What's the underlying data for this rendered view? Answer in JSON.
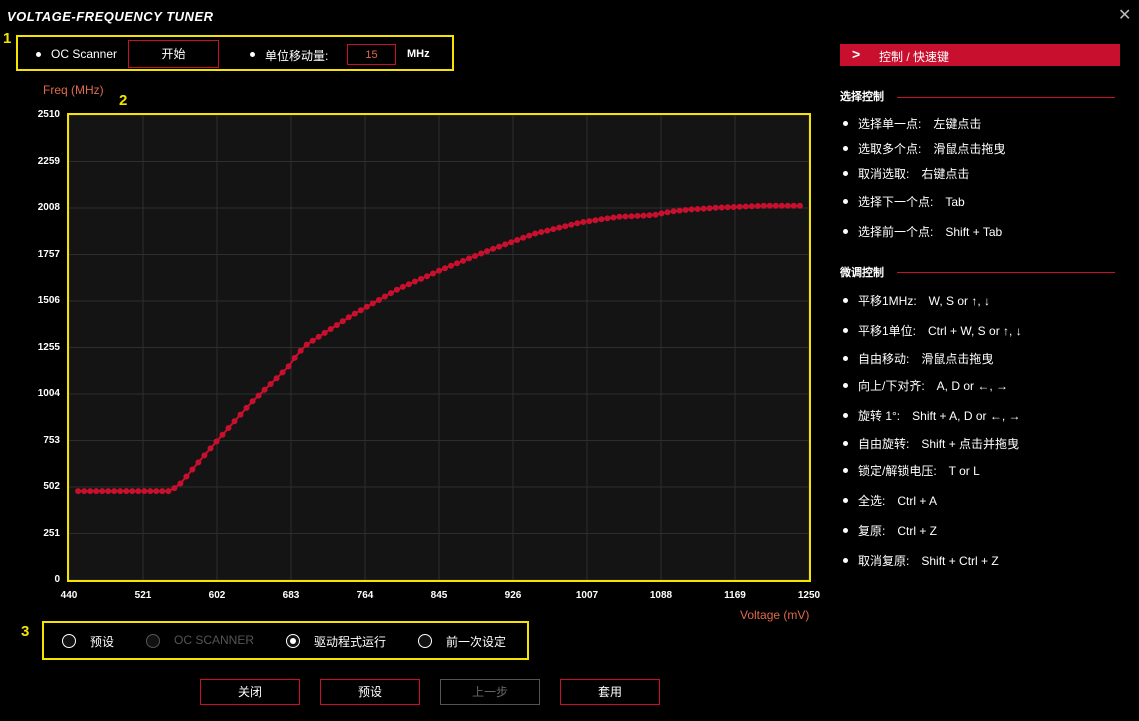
{
  "window": {
    "title": "VOLTAGE-FREQUENCY TUNER",
    "close_icon": "close-icon"
  },
  "annotations": [
    "1",
    "2",
    "3"
  ],
  "top_bar": {
    "oc_scanner_label": "OC Scanner",
    "start_button": "开始",
    "step_label": "单位移动量:",
    "step_value": "15",
    "step_unit": "MHz"
  },
  "chart_data": {
    "type": "line",
    "ylabel": "Freq (MHz)",
    "xlabel": "Voltage (mV)",
    "xlim": [
      440,
      1250
    ],
    "ylim": [
      0,
      2510
    ],
    "x_ticks": [
      "440",
      "521",
      "602",
      "683",
      "764",
      "845",
      "926",
      "1007",
      "1088",
      "1169",
      "1250"
    ],
    "y_ticks": [
      "0",
      "251",
      "502",
      "753",
      "1004",
      "1255",
      "1506",
      "1757",
      "2008",
      "2259",
      "2510"
    ],
    "grid": true,
    "color": "#c8102e",
    "series": [
      {
        "x": [
          450,
          550,
          560,
          600,
          640,
          680,
          690,
          700,
          750,
          800,
          850,
          900,
          950,
          1000,
          1040,
          1080,
          1100,
          1120,
          1150,
          1200,
          1240
        ],
        "y": [
          480,
          480,
          510,
          740,
          960,
          1150,
          1220,
          1270,
          1430,
          1570,
          1680,
          1780,
          1870,
          1930,
          1960,
          1970,
          1990,
          2000,
          2010,
          2020,
          2020
        ]
      }
    ]
  },
  "profiles": {
    "options": [
      {
        "label": "预设",
        "disabled": false,
        "checked": false
      },
      {
        "label": "OC SCANNER",
        "disabled": true,
        "checked": false
      },
      {
        "label": "驱动程式运行",
        "disabled": false,
        "checked": true
      },
      {
        "label": "前一次设定",
        "disabled": false,
        "checked": false
      }
    ]
  },
  "buttons": {
    "close": "关闭",
    "preset": "预设",
    "undo": "上一步",
    "apply": "套用"
  },
  "help_panel": {
    "header_arrow": ">",
    "header": "控制 / 快速键",
    "select_title": "选择控制",
    "select_items": [
      {
        "action": "选择单一点:",
        "key": "左键点击"
      },
      {
        "action": "选取多个点:",
        "key": "滑鼠点击拖曳"
      },
      {
        "action": "取消选取:",
        "key": "右键点击"
      },
      {
        "action": "选择下一个点:",
        "key": "Tab"
      },
      {
        "action": "选择前一个点:",
        "key": "Shift + Tab"
      }
    ],
    "fine_title": "微调控制",
    "fine_items": [
      {
        "action": "平移1MHz:",
        "key": "W, S or ↑, ↓"
      },
      {
        "action": "平移1单位:",
        "key": "Ctrl + W, S or ↑, ↓"
      },
      {
        "action": "自由移动:",
        "key": "滑鼠点击拖曳"
      },
      {
        "action": "向上/下对齐:",
        "key": "A, D or ←, →"
      },
      {
        "action": "旋转 1°:",
        "key": "Shift + A, D or ←, →"
      },
      {
        "action": "自由旋转:",
        "key": "Shift + 点击并拖曳"
      },
      {
        "action": "锁定/解锁电压:",
        "key": "T or L"
      },
      {
        "action": "全选:",
        "key": "Ctrl + A"
      },
      {
        "action": "复原:",
        "key": "Ctrl + Z"
      },
      {
        "action": "取消复原:",
        "key": "Shift + Ctrl + Z"
      }
    ]
  }
}
